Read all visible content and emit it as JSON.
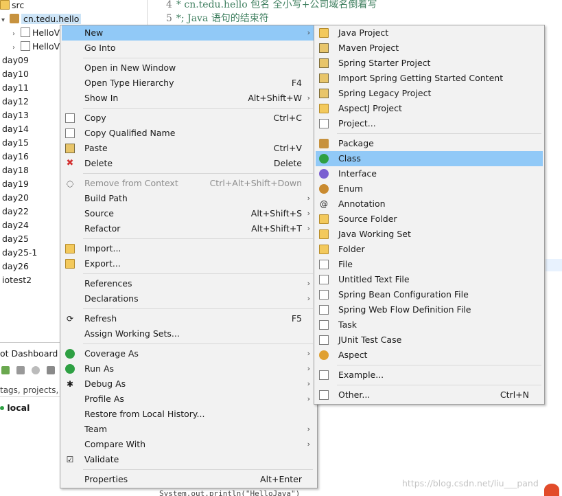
{
  "tree": {
    "src_label": "src",
    "selected_package": "cn.tedu.hello",
    "files": [
      "HelloV",
      "HelloV"
    ],
    "folders": [
      "day09",
      "day10",
      "day11",
      "day12",
      "day13",
      "day14",
      "day15",
      "day16",
      "day18",
      "day19",
      "day20",
      "day22",
      "day24",
      "day25",
      "day25-1",
      "day26",
      "iotest2"
    ]
  },
  "editor": {
    "lines": [
      {
        "num": "4",
        "text": "* cn.tedu.hello 包名 全小写+公司域名倒着写"
      },
      {
        "num": "5",
        "text": "*; Java 语句的结束符"
      }
    ],
    "bottom_fragment": "System.out.println(\"HelloJava\")"
  },
  "dashboard": {
    "tab": "ot Dashboard",
    "filter_placeholder": "tags, projects,",
    "local_label": "local"
  },
  "context_menu": {
    "items": [
      {
        "label": "New",
        "shortcut": "",
        "submenu": true,
        "highlighted": true,
        "icon": "none"
      },
      {
        "label": "Go Into",
        "shortcut": "",
        "submenu": false,
        "icon": "none"
      },
      {
        "sep": true
      },
      {
        "label": "Open in New Window",
        "shortcut": "",
        "submenu": false,
        "icon": "none"
      },
      {
        "label": "Open Type Hierarchy",
        "shortcut": "F4",
        "submenu": false,
        "icon": "none"
      },
      {
        "label": "Show In",
        "shortcut": "Alt+Shift+W",
        "submenu": true,
        "icon": "none"
      },
      {
        "sep": true
      },
      {
        "label": "Copy",
        "shortcut": "Ctrl+C",
        "submenu": false,
        "icon": "copy-icon"
      },
      {
        "label": "Copy Qualified Name",
        "shortcut": "",
        "submenu": false,
        "icon": "copy-qualified-icon"
      },
      {
        "label": "Paste",
        "shortcut": "Ctrl+V",
        "submenu": false,
        "icon": "paste-icon"
      },
      {
        "label": "Delete",
        "shortcut": "Delete",
        "submenu": false,
        "icon": "delete-icon"
      },
      {
        "sep": true
      },
      {
        "label": "Remove from Context",
        "shortcut": "Ctrl+Alt+Shift+Down",
        "submenu": false,
        "disabled": true,
        "icon": "remove-context-icon"
      },
      {
        "label": "Build Path",
        "shortcut": "",
        "submenu": true,
        "icon": "none"
      },
      {
        "label": "Source",
        "shortcut": "Alt+Shift+S",
        "submenu": true,
        "icon": "none"
      },
      {
        "label": "Refactor",
        "shortcut": "Alt+Shift+T",
        "submenu": true,
        "icon": "none"
      },
      {
        "sep": true
      },
      {
        "label": "Import...",
        "shortcut": "",
        "submenu": false,
        "icon": "import-icon"
      },
      {
        "label": "Export...",
        "shortcut": "",
        "submenu": false,
        "icon": "export-icon"
      },
      {
        "sep": true
      },
      {
        "label": "References",
        "shortcut": "",
        "submenu": true,
        "icon": "none"
      },
      {
        "label": "Declarations",
        "shortcut": "",
        "submenu": true,
        "icon": "none"
      },
      {
        "sep": true
      },
      {
        "label": "Refresh",
        "shortcut": "F5",
        "submenu": false,
        "icon": "refresh-icon"
      },
      {
        "label": "Assign Working Sets...",
        "shortcut": "",
        "submenu": false,
        "icon": "none"
      },
      {
        "sep": true
      },
      {
        "label": "Coverage As",
        "shortcut": "",
        "submenu": true,
        "icon": "coverage-icon"
      },
      {
        "label": "Run As",
        "shortcut": "",
        "submenu": true,
        "icon": "run-icon"
      },
      {
        "label": "Debug As",
        "shortcut": "",
        "submenu": true,
        "icon": "debug-icon"
      },
      {
        "label": "Profile As",
        "shortcut": "",
        "submenu": true,
        "icon": "none"
      },
      {
        "label": "Restore from Local History...",
        "shortcut": "",
        "submenu": false,
        "icon": "none"
      },
      {
        "label": "Team",
        "shortcut": "",
        "submenu": true,
        "icon": "none"
      },
      {
        "label": "Compare With",
        "shortcut": "",
        "submenu": true,
        "icon": "none"
      },
      {
        "label": "Validate",
        "shortcut": "",
        "submenu": false,
        "icon": "validate-icon"
      },
      {
        "sep": true
      },
      {
        "label": "Properties",
        "shortcut": "Alt+Enter",
        "submenu": false,
        "icon": "none"
      }
    ]
  },
  "new_submenu": {
    "items": [
      {
        "label": "Java Project",
        "shortcut": "",
        "icon": "java-project-icon"
      },
      {
        "label": "Maven Project",
        "shortcut": "",
        "icon": "maven-project-icon"
      },
      {
        "label": "Spring Starter Project",
        "shortcut": "",
        "icon": "spring-starter-icon"
      },
      {
        "label": "Import Spring Getting Started Content",
        "shortcut": "",
        "icon": "spring-import-icon"
      },
      {
        "label": "Spring Legacy Project",
        "shortcut": "",
        "icon": "spring-legacy-icon"
      },
      {
        "label": "AspectJ Project",
        "shortcut": "",
        "icon": "aspectj-project-icon"
      },
      {
        "label": "Project...",
        "shortcut": "",
        "icon": "project-icon"
      },
      {
        "sep": true
      },
      {
        "label": "Package",
        "shortcut": "",
        "icon": "package-icon"
      },
      {
        "label": "Class",
        "shortcut": "",
        "icon": "class-icon",
        "highlighted": true
      },
      {
        "label": "Interface",
        "shortcut": "",
        "icon": "interface-icon"
      },
      {
        "label": "Enum",
        "shortcut": "",
        "icon": "enum-icon"
      },
      {
        "label": "Annotation",
        "shortcut": "",
        "icon": "annotation-icon"
      },
      {
        "label": "Source Folder",
        "shortcut": "",
        "icon": "source-folder-icon"
      },
      {
        "label": "Java Working Set",
        "shortcut": "",
        "icon": "working-set-icon"
      },
      {
        "label": "Folder",
        "shortcut": "",
        "icon": "folder-icon"
      },
      {
        "label": "File",
        "shortcut": "",
        "icon": "file-icon"
      },
      {
        "label": "Untitled Text File",
        "shortcut": "",
        "icon": "text-file-icon"
      },
      {
        "label": "Spring Bean Configuration File",
        "shortcut": "",
        "icon": "spring-bean-icon"
      },
      {
        "label": "Spring Web Flow Definition File",
        "shortcut": "",
        "icon": "web-flow-icon"
      },
      {
        "label": "Task",
        "shortcut": "",
        "icon": "task-icon"
      },
      {
        "label": "JUnit Test Case",
        "shortcut": "",
        "icon": "junit-icon"
      },
      {
        "label": "Aspect",
        "shortcut": "",
        "icon": "aspect-icon"
      },
      {
        "sep": true
      },
      {
        "label": "Example...",
        "shortcut": "",
        "icon": "example-icon"
      },
      {
        "sep": true
      },
      {
        "label": "Other...",
        "shortcut": "Ctrl+N",
        "icon": "other-icon"
      }
    ]
  },
  "watermark": "https://blog.csdn.net/liu___pand",
  "colors": {
    "menu_bg": "#f2f2f2",
    "highlight": "#91c9f7",
    "tree_selection": "#cce4f7",
    "comment_green": "#3f7f5f"
  }
}
